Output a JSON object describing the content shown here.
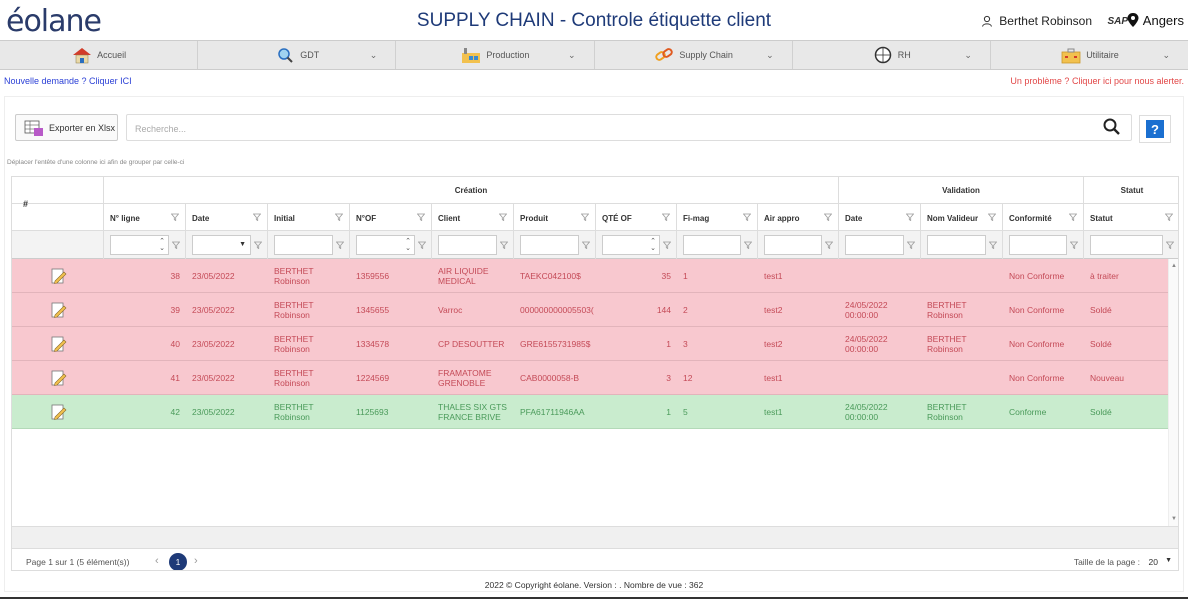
{
  "header": {
    "logo": "éolane",
    "title": "SUPPLY CHAIN - Controle étiquette client",
    "user": "Berthet Robinson",
    "sap_label": "SAP",
    "site": "Angers"
  },
  "nav": [
    {
      "label": "Accueil",
      "icon": "house-icon"
    },
    {
      "label": "GDT",
      "icon": "magnifier-icon"
    },
    {
      "label": "Production",
      "icon": "factory-icon"
    },
    {
      "label": "Supply Chain",
      "icon": "chain-link-icon"
    },
    {
      "label": "RH",
      "icon": "compass-icon"
    },
    {
      "label": "Utilitaire",
      "icon": "toolbox-icon"
    }
  ],
  "links": {
    "new_request": "Nouvelle demande ? Cliquer ICI",
    "alert": "Un problème ? Cliquer ici pour nous alerter."
  },
  "toolbar": {
    "export_label": "Exporter en Xlsx",
    "search_placeholder": "Recherche...",
    "help_label": "?",
    "group_hint": "Déplacer l'entête d'une colonne ici afin de grouper par celle-ci"
  },
  "grid": {
    "row_header": "#",
    "bands": {
      "creation": "Création",
      "validation": "Validation",
      "statut": "Statut"
    },
    "columns": [
      "N° ligne",
      "Date",
      "Initial",
      "N°OF",
      "Client",
      "Produit",
      "QTÉ OF",
      "Fi-mag",
      "Air appro",
      "Date",
      "Nom Valideur",
      "Conformité",
      "Statut"
    ],
    "rows": [
      {
        "state": "nc",
        "ligne": "38",
        "date": "23/05/2022",
        "initial": "BERTHET Robinson",
        "of": "1359556",
        "client": "AIR LIQUIDE MEDICAL",
        "produit": "TAEKC042100$",
        "qte": "35",
        "fimag": "1",
        "air": "test1",
        "vdate": "",
        "valideur": "",
        "conformite": "Non Conforme",
        "statut": "à traiter"
      },
      {
        "state": "nc",
        "ligne": "39",
        "date": "23/05/2022",
        "initial": "BERTHET Robinson",
        "of": "1345655",
        "client": "Varroc",
        "produit": "000000000005503(",
        "qte": "144",
        "fimag": "2",
        "air": "test2",
        "vdate": "24/05/2022 00:00:00",
        "valideur": "BERTHET Robinson",
        "conformite": "Non Conforme",
        "statut": "Soldé"
      },
      {
        "state": "nc",
        "ligne": "40",
        "date": "23/05/2022",
        "initial": "BERTHET Robinson",
        "of": "1334578",
        "client": "CP DESOUTTER",
        "produit": "GRE6155731985$",
        "qte": "1",
        "fimag": "3",
        "air": "test2",
        "vdate": "24/05/2022 00:00:00",
        "valideur": "BERTHET Robinson",
        "conformite": "Non Conforme",
        "statut": "Soldé"
      },
      {
        "state": "nc",
        "ligne": "41",
        "date": "23/05/2022",
        "initial": "BERTHET Robinson",
        "of": "1224569",
        "client": "FRAMATOME GRENOBLE",
        "produit": "CAB0000058-B",
        "qte": "3",
        "fimag": "12",
        "air": "test1",
        "vdate": "",
        "valideur": "",
        "conformite": "Non Conforme",
        "statut": "Nouveau"
      },
      {
        "state": "c",
        "ligne": "42",
        "date": "23/05/2022",
        "initial": "BERTHET Robinson",
        "of": "1125693",
        "client": "THALES SIX GTS FRANCE BRIVE",
        "produit": "PFA61711946AA",
        "qte": "1",
        "fimag": "5",
        "air": "test1",
        "vdate": "24/05/2022 00:00:00",
        "valideur": "BERTHET Robinson",
        "conformite": "Conforme",
        "statut": "Soldé"
      }
    ]
  },
  "pager": {
    "info": "Page 1 sur 1 (5 élément(s))",
    "current": "1",
    "size_label": "Taille de la page :",
    "size": "20"
  },
  "footer": "2022 © Copyright éolane. Version : . Nombre de vue : 362",
  "colors": {
    "non_conforme_bg": "#f8c8cf",
    "conforme_bg": "#c9ecce",
    "brand": "#1e3a78"
  }
}
